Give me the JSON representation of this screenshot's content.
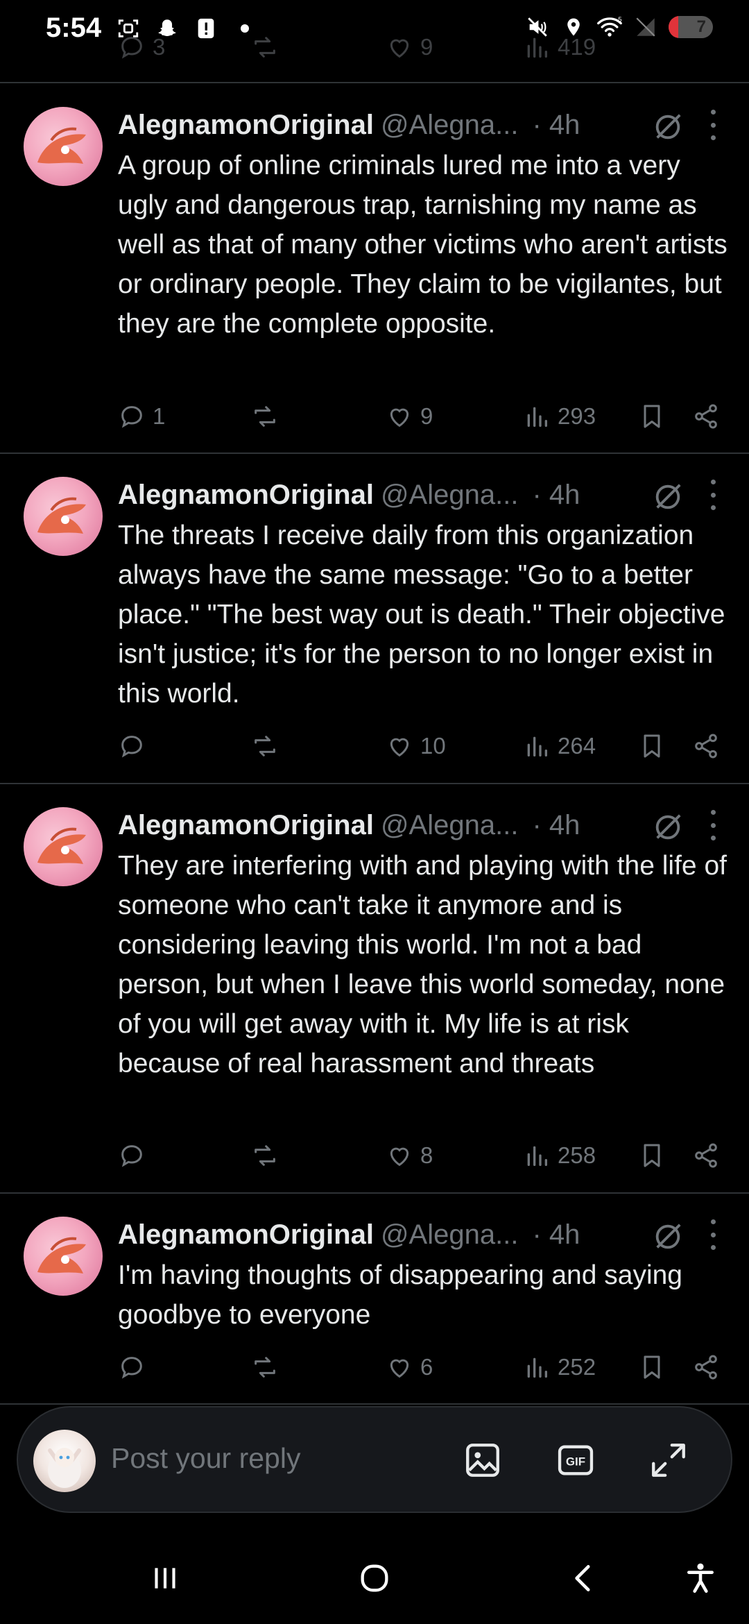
{
  "status_bar": {
    "time": "5:54",
    "battery_level": "7",
    "battery_fraction": 0.07,
    "left_icons": [
      "screenshot-icon",
      "snapchat-icon",
      "alert-icon",
      "dot-icon"
    ],
    "right_icons": [
      "mute-icon",
      "location-icon",
      "wifi-icon",
      "signal-icon",
      "battery-icon"
    ]
  },
  "previous_tweet_actions": {
    "replies": "3",
    "likes": "9",
    "views": "419"
  },
  "tweets": [
    {
      "name": "AlegnamonOriginal",
      "handle": "@Alegna...",
      "time": "· 4h",
      "text": "A group of online criminals lured me into a very ugly and dangerous trap, tarnishing my name as well as that of many other victims who aren't artists or ordinary people. They claim to be vigilantes, but they are the complete opposite.",
      "replies": "1",
      "reposts": "",
      "likes": "9",
      "views": "293"
    },
    {
      "name": "AlegnamonOriginal",
      "handle": "@Alegna...",
      "time": "· 4h",
      "text": "The threats I receive daily from this organization always have the same message: \"Go to a better place.\" \"The best way out is death.\" Their objective isn't justice; it's for the person to no longer exist in this world.",
      "replies": "",
      "reposts": "",
      "likes": "10",
      "views": "264"
    },
    {
      "name": "AlegnamonOriginal",
      "handle": "@Alegna...",
      "time": "· 4h",
      "text": "They are interfering with and playing with the life of someone who can't take it anymore and is considering leaving this world. I'm not a bad person, but when I leave this world someday, none of you will get away with it. My life is at risk because of real harassment and threats",
      "replies": "",
      "reposts": "",
      "likes": "8",
      "views": "258"
    },
    {
      "name": "AlegnamonOriginal",
      "handle": "@Alegna...",
      "time": "· 4h",
      "text": "I'm having thoughts of disappearing and saying goodbye to everyone",
      "replies": "",
      "reposts": "",
      "likes": "6",
      "views": "252"
    }
  ],
  "reply_bar": {
    "placeholder": "Post your reply",
    "icons": [
      "image-icon",
      "gif-icon",
      "expand-icon"
    ]
  },
  "nav_bar": {
    "icons": [
      "recents-icon",
      "home-icon",
      "back-icon",
      "accessibility-icon"
    ]
  },
  "colors": {
    "background": "#000000",
    "text": "#e7e9ea",
    "muted": "#71767b",
    "divider": "#2f3336",
    "battery": "#e0333a"
  }
}
